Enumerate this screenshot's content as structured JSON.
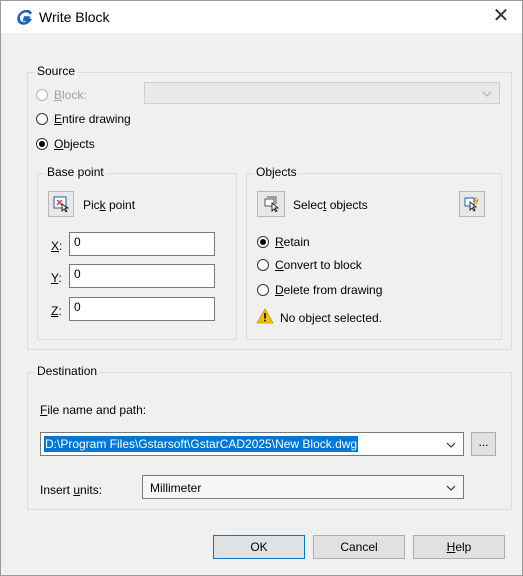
{
  "window": {
    "title": "Write Block",
    "close_glyph": "✕"
  },
  "source": {
    "legend": "Source",
    "block_label_pre": "B",
    "block_label_post": "lock:",
    "entire_label_pre": "E",
    "entire_label_post": "ntire drawing",
    "objects_label_pre": "O",
    "objects_label_post": "bjects",
    "selected": "Objects"
  },
  "base_point": {
    "legend": "Base point",
    "pick_label_pre": "Pic",
    "pick_label_u": "k",
    "pick_label_post": " point",
    "x_label": "X",
    "x_value": "0",
    "y_label": "Y",
    "y_value": "0",
    "z_label": "Z",
    "z_value": "0"
  },
  "objects": {
    "legend": "Objects",
    "select_label_pre": "Selec",
    "select_label_u": "t",
    "select_label_post": " objects",
    "retain_pre": "R",
    "retain_post": "etain",
    "convert_pre": "C",
    "convert_post": "onvert to block",
    "delete_pre": "D",
    "delete_post": "elete from drawing",
    "selected_option": "Retain",
    "warning": "No object selected."
  },
  "destination": {
    "legend": "Destination",
    "file_label_pre": "F",
    "file_label_post": "ile name and path:",
    "path_value": "D:\\Program Files\\Gstarsoft\\GstarCAD2025\\New Block.dwg",
    "browse_label": "...",
    "units_label_pre": "Insert ",
    "units_label_u": "u",
    "units_label_post": "nits:",
    "units_value": "Millimeter"
  },
  "buttons": {
    "ok": "OK",
    "cancel": "Cancel",
    "help_pre": "",
    "help_u": "H",
    "help_post": "elp"
  },
  "colors": {
    "accent": "#0078d7",
    "warning": "#f2c200",
    "app_icon": "#1565c0"
  }
}
